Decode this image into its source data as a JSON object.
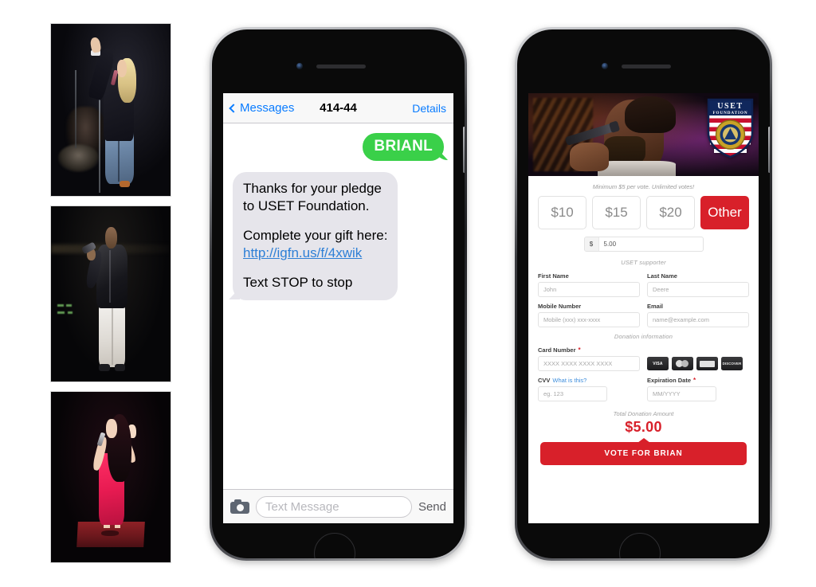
{
  "photos": [
    {
      "name": "photo-blonde-singer",
      "alt": "Blonde female singer on stage with arm raised"
    },
    {
      "name": "photo-male-singer",
      "alt": "Male singer in dark jacket and white pants"
    },
    {
      "name": "photo-pink-dress-singer",
      "alt": "Female singer in pink dress on riser"
    }
  ],
  "messages_phone": {
    "navbar": {
      "back_label": "Messages",
      "title": "414-44",
      "details_label": "Details"
    },
    "thread": {
      "outgoing": {
        "text": "BRIANL"
      },
      "incoming": {
        "line1": "Thanks for your pledge",
        "line2": "to USET Foundation.",
        "line3": "Complete your gift here:",
        "link": "http://igfn.us/f/4xwik",
        "line4": "Text STOP to stop"
      }
    },
    "input_bar": {
      "camera_icon": "camera-icon",
      "placeholder": "Text Message",
      "send_label": "Send"
    }
  },
  "donation_phone": {
    "hero": {
      "alt": "Male singer performing into a microphone",
      "logo": {
        "top_text": "USET",
        "bottom_text": "FOUNDATION"
      }
    },
    "hint": "Minimum $5 per vote. Unlimited votes!",
    "amount_buttons": [
      {
        "label": "$10",
        "selected": false
      },
      {
        "label": "$15",
        "selected": false
      },
      {
        "label": "$20",
        "selected": false
      },
      {
        "label": "Other",
        "selected": true
      }
    ],
    "custom_amount": {
      "prefix": "$",
      "value": "5.00"
    },
    "supporter_section": {
      "heading": "USET supporter",
      "fields": [
        {
          "label": "First Name",
          "placeholder": "John",
          "required": false
        },
        {
          "label": "Last Name",
          "placeholder": "Deere",
          "required": false
        },
        {
          "label": "Mobile Number",
          "placeholder": "Mobile (xxx) xxx-xxxx",
          "required": false
        },
        {
          "label": "Email",
          "placeholder": "name@example.com",
          "required": false
        }
      ]
    },
    "donation_section": {
      "heading": "Donation information",
      "card_number": {
        "label": "Card Number",
        "placeholder": "XXXX XXXX XXXX XXXX",
        "required": true
      },
      "card_brands": [
        "VISA",
        "MASTERCARD",
        "AMEX",
        "DISCOVER"
      ],
      "cvv": {
        "label": "CVV",
        "help_link": "What is this?",
        "placeholder": "eg. 123",
        "required": false
      },
      "expiration": {
        "label": "Expiration Date",
        "placeholder": "MM/YYYY",
        "required": true
      }
    },
    "total": {
      "label": "Total Donation Amount",
      "amount": "$5.00"
    },
    "vote_button": {
      "label": "VOTE FOR BRIAN"
    }
  },
  "colors": {
    "brand_red": "#d8202a",
    "imessage_green": "#3ad049",
    "ios_blue": "#0a7cff"
  }
}
